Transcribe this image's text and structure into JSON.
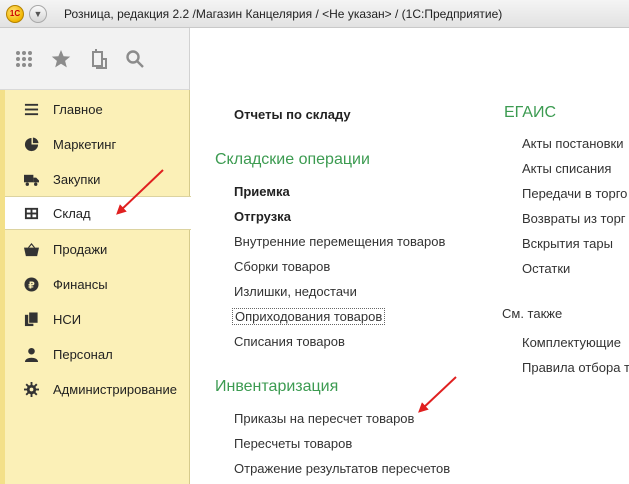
{
  "titlebar": {
    "logo": "1С",
    "title": "Розница, редакция 2.2 /Магазин Канцелярия / <Не указан> /  (1С:Предприятие)"
  },
  "toolbar": {
    "icons": [
      "grid-icon",
      "star-icon",
      "history-icon",
      "search-icon"
    ]
  },
  "sidebar": {
    "items": [
      {
        "label": "Главное",
        "icon": "menu-lines-icon"
      },
      {
        "label": "Маркетинг",
        "icon": "pie-chart-icon"
      },
      {
        "label": "Закупки",
        "icon": "truck-icon"
      },
      {
        "label": "Склад",
        "icon": "warehouse-icon",
        "active": true
      },
      {
        "label": "Продажи",
        "icon": "basket-icon"
      },
      {
        "label": "Финансы",
        "icon": "ruble-icon"
      },
      {
        "label": "НСИ",
        "icon": "documents-icon"
      },
      {
        "label": "Персонал",
        "icon": "person-icon"
      },
      {
        "label": "Администрирование",
        "icon": "gear-icon"
      }
    ]
  },
  "main": {
    "reports": "Отчеты по складу",
    "ops_header": "Складские операции",
    "ops": [
      "Приемка",
      "Отгрузка",
      "Внутренние перемещения товаров",
      "Сборки товаров",
      "Излишки, недостачи",
      "Оприходования товаров",
      "Списания товаров"
    ],
    "inv_header": "Инвентаризация",
    "inv": [
      "Приказы на пересчет товаров",
      "Пересчеты товаров",
      "Отражение результатов пересчетов"
    ],
    "egais_header": "ЕГАИС",
    "egais": [
      "Акты постановки",
      "Акты списания",
      "Передачи в торго",
      "Возвраты из торг",
      "Вскрытия тары",
      "Остатки"
    ],
    "see_also": "См. также",
    "see_also_items": [
      "Комплектующие",
      "Правила отбора т"
    ]
  },
  "colors": {
    "sidebar_bg": "#fbf0b7",
    "section_green": "#3c9b51",
    "arrow_red": "#e02020"
  }
}
